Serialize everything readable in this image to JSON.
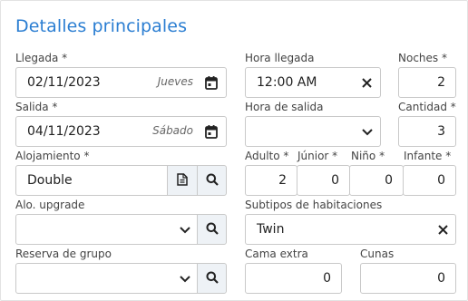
{
  "section_title": "Detalles principales",
  "arrival": {
    "label": "Llegada *",
    "value": "02/11/2023",
    "weekday": "Jueves"
  },
  "arrival_time": {
    "label": "Hora llegada",
    "value": "12:00 AM"
  },
  "nights": {
    "label": "Noches *",
    "value": "2"
  },
  "departure": {
    "label": "Salida *",
    "value": "04/11/2023",
    "weekday": "Sábado"
  },
  "departure_time": {
    "label": "Hora de salida",
    "value": ""
  },
  "quantity": {
    "label": "Cantidad *",
    "value": "3"
  },
  "accommodation": {
    "label": "Alojamiento *",
    "value": "Double"
  },
  "adult": {
    "label": "Adulto *",
    "value": "2"
  },
  "junior": {
    "label": "Júnior *",
    "value": "0"
  },
  "child": {
    "label": "Niño *",
    "value": "0"
  },
  "infant": {
    "label": "Infante *",
    "value": "0"
  },
  "upgrade": {
    "label": "Alo. upgrade",
    "value": ""
  },
  "room_subtypes": {
    "label": "Subtipos de habitaciones",
    "value": "Twin"
  },
  "group_booking": {
    "label": "Reserva de grupo",
    "value": ""
  },
  "extra_bed": {
    "label": "Cama extra",
    "value": "0"
  },
  "cribs": {
    "label": "Cunas",
    "value": "0"
  },
  "icons": {
    "calendar": "calendar-icon",
    "clear": "close-icon",
    "dropdown": "chevron-down-icon",
    "search": "search-icon",
    "document": "document-icon"
  },
  "colors": {
    "title": "#2b7ed2",
    "button_bg": "#eef2f6",
    "border": "#c9c9c9"
  }
}
